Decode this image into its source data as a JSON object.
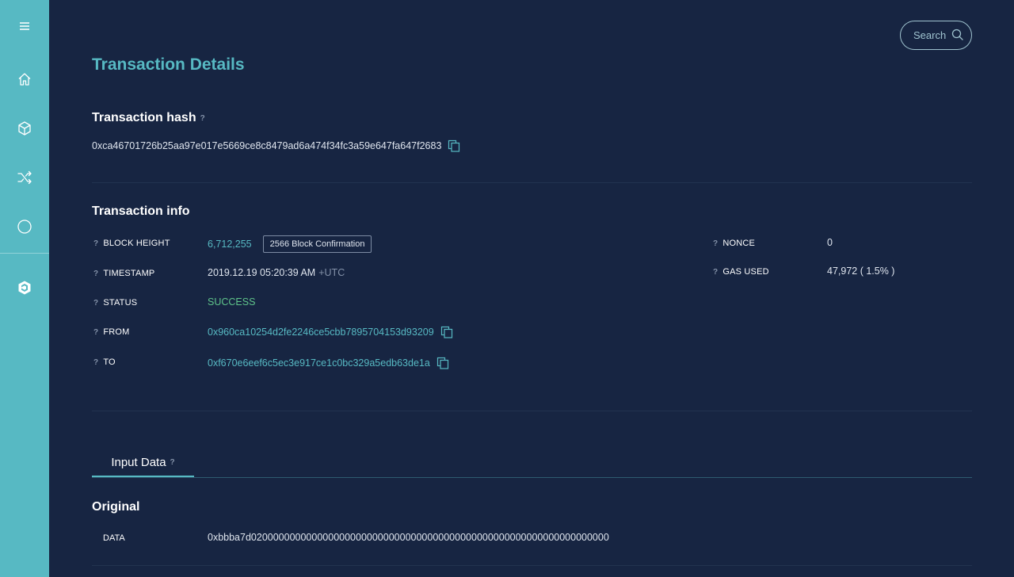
{
  "sidebar": {
    "items": [
      {
        "icon": "menu-icon"
      },
      {
        "icon": "home-icon"
      },
      {
        "icon": "cube-icon"
      },
      {
        "icon": "shuffle-icon"
      },
      {
        "icon": "circle-icon"
      },
      {
        "icon": "logo-icon"
      }
    ],
    "accent": "#57b9c3"
  },
  "search": {
    "label": "Search",
    "icon": "search-icon"
  },
  "page": {
    "title": "Transaction Details"
  },
  "hash_section": {
    "title": "Transaction hash",
    "help": "?",
    "value": "0xca46701726b25aa97e017e5669ce8c8479ad6a474f34fc3a59e647fa647f2683"
  },
  "info_section": {
    "title": "Transaction info",
    "block_height": {
      "label": "BLOCK HEIGHT",
      "value": "6,712,255",
      "badge": "2566 Block Confirmation"
    },
    "timestamp": {
      "label": "TIMESTAMP",
      "value": "2019.12.19 05:20:39 AM",
      "tz": "+UTC"
    },
    "status": {
      "label": "STATUS",
      "value": "SUCCESS"
    },
    "from": {
      "label": "FROM",
      "value": "0x960ca10254d2fe2246ce5cbb7895704153d93209"
    },
    "to": {
      "label": "TO",
      "value": "0xf670e6eef6c5ec3e917ce1c0bc329a5edb63de1a"
    },
    "nonce": {
      "label": "NONCE",
      "value": "0"
    },
    "gas_used": {
      "label": "GAS USED",
      "value": "47,972 ( 1.5% )"
    }
  },
  "input_data": {
    "tab_label": "Input Data",
    "subtitle": "Original",
    "data_label": "DATA",
    "data_value": "0xbbba7d02000000000000000000000000000000000000000000000000000000000000000"
  },
  "colors": {
    "background": "#172542",
    "accent": "#57b9c3",
    "success": "#5fc48a"
  }
}
